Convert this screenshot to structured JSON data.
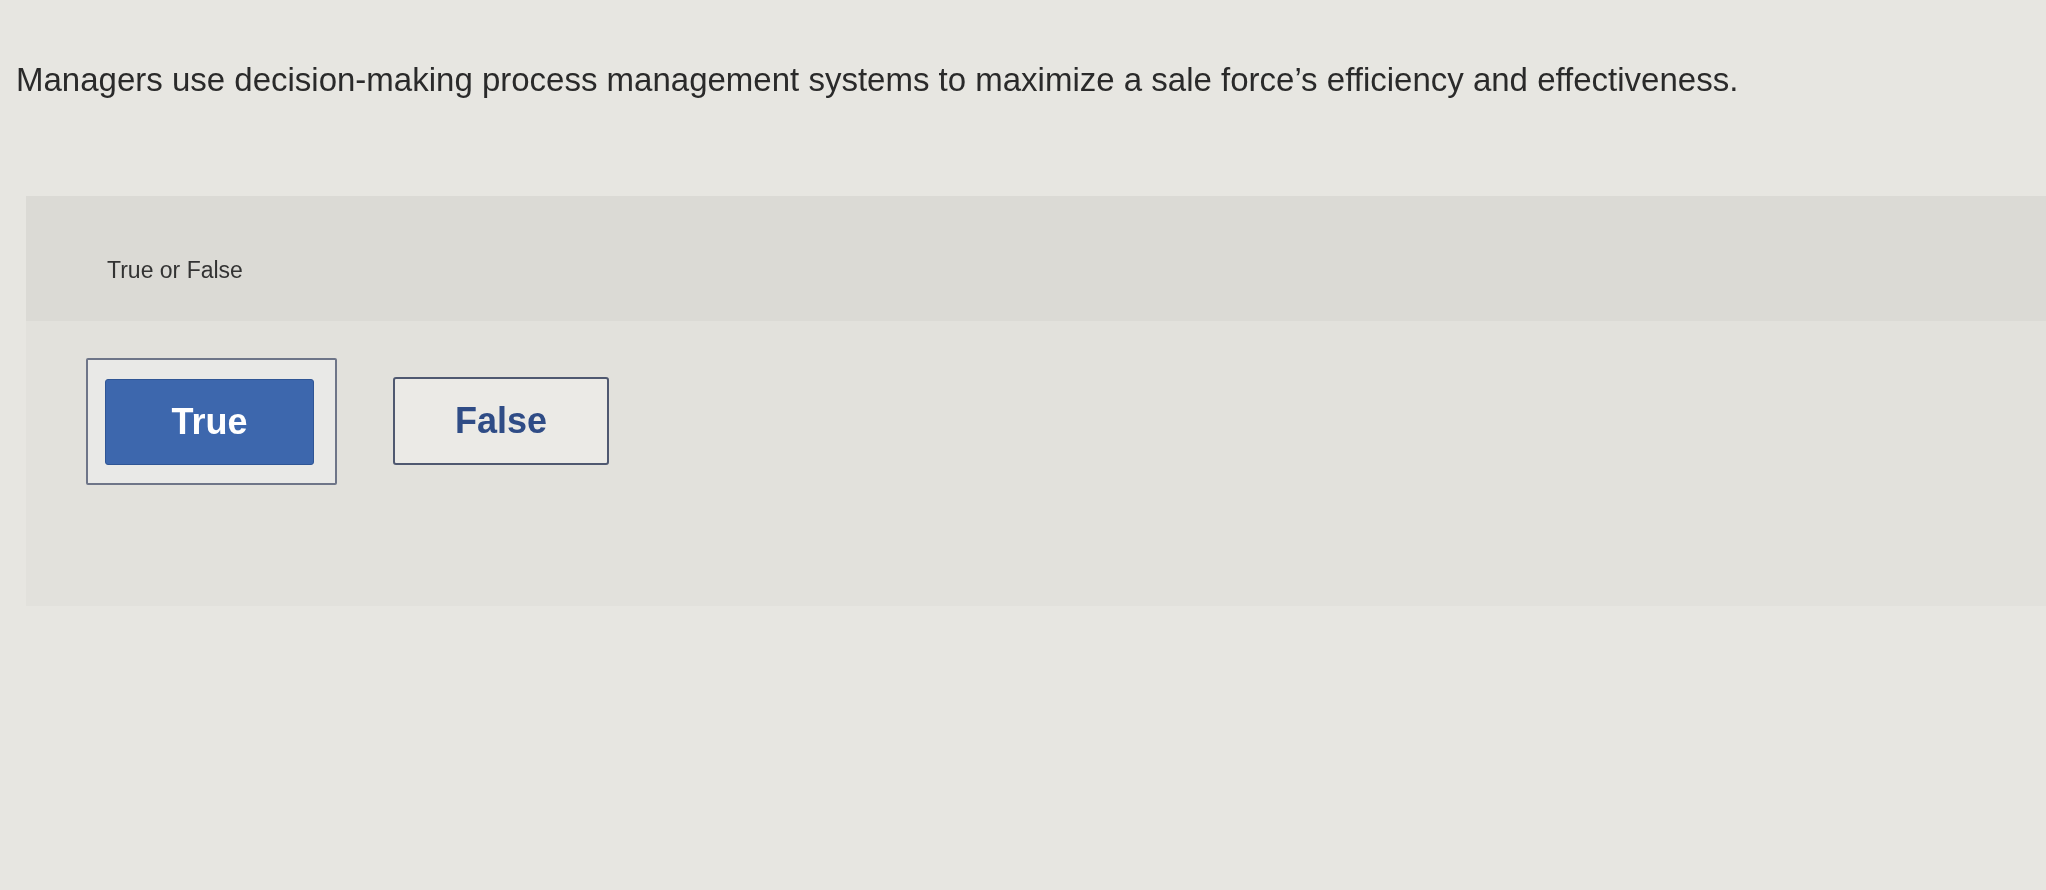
{
  "question": {
    "text": "Managers use decision-making process management systems to maximize a sale force’s efficiency and effectiveness."
  },
  "answer_panel": {
    "prompt": "True or False",
    "options": [
      {
        "label": "True",
        "selected": true
      },
      {
        "label": "False",
        "selected": false
      }
    ]
  }
}
